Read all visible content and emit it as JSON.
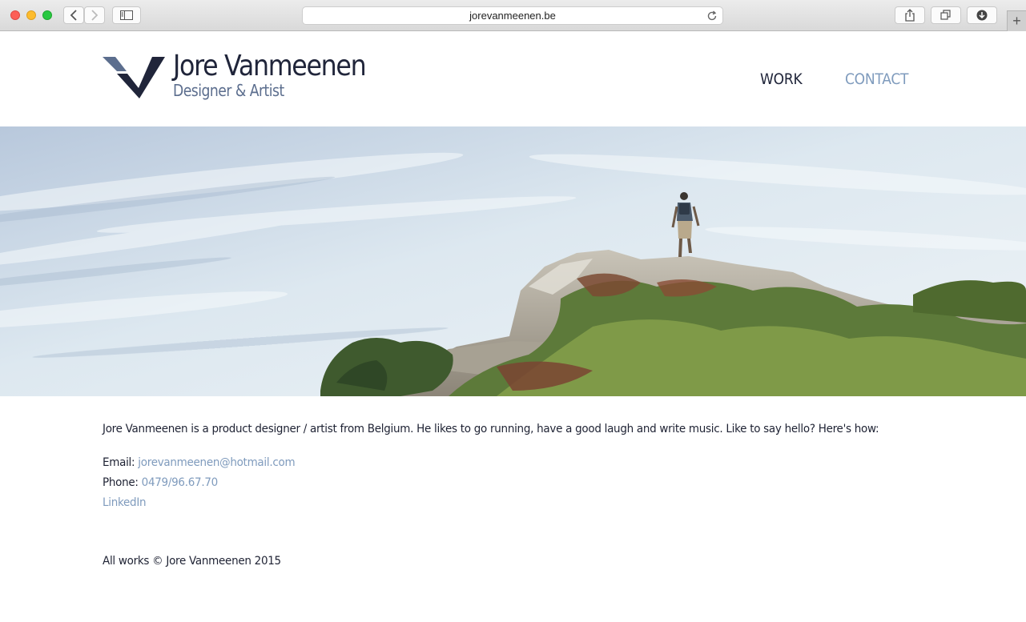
{
  "browser": {
    "url": "jorevanmeenen.be",
    "new_tab_glyph": "+"
  },
  "site": {
    "name": "Jore Vanmeenen",
    "tagline": "Designer & Artist",
    "nav": [
      {
        "label": "WORK"
      },
      {
        "label": "CONTACT"
      }
    ]
  },
  "about": {
    "intro": "Jore Vanmeenen is a product designer / artist from Belgium. He likes to go running, have a good laugh and write music. Like to say hello? Here's how:",
    "email_label": "Email: ",
    "email": "jorevanmeenen@hotmail.com",
    "phone_label": "Phone: ",
    "phone": "0479/96.67.70",
    "linkedin": "LinkedIn"
  },
  "footer": {
    "copyright": "All works © Jore Vanmeenen 2015"
  },
  "colors": {
    "brand_dark": "#20253a",
    "brand_blue": "#5c6e8e",
    "link": "#7f9bbd"
  }
}
